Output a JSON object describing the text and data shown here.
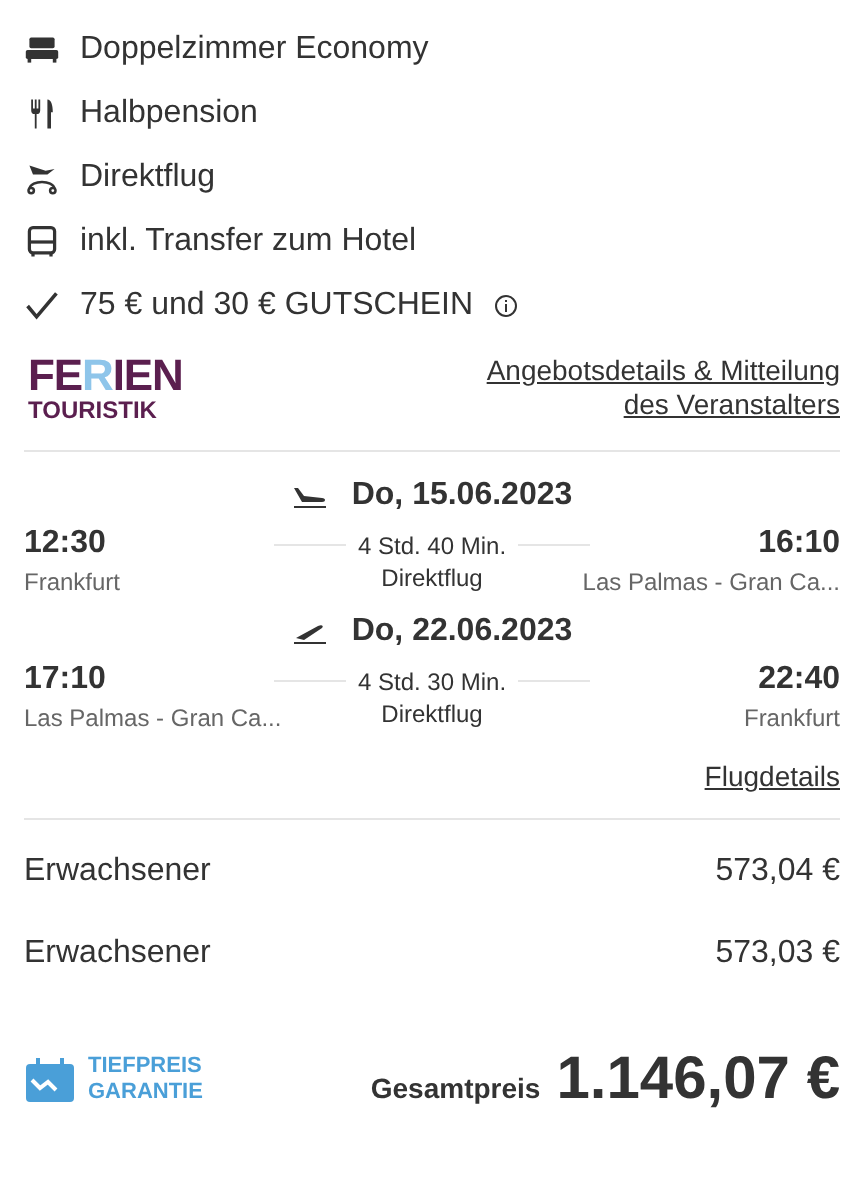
{
  "features": [
    {
      "kind": "bed",
      "text": "Doppelzimmer Economy",
      "info": false
    },
    {
      "kind": "meal",
      "text": "Halbpension",
      "info": false
    },
    {
      "kind": "flight",
      "text": "Direktflug",
      "info": false
    },
    {
      "kind": "bus",
      "text": "inkl. Transfer zum Hotel",
      "info": false
    },
    {
      "kind": "check",
      "text": "75 € und 30 € GUTSCHEIN",
      "info": true
    }
  ],
  "operator": {
    "logo_line1": [
      {
        "text": "FE",
        "color": "#5b1f4f"
      },
      {
        "text": "R",
        "color": "#8ec5ea"
      },
      {
        "text": "IEN",
        "color": "#5b1f4f"
      }
    ],
    "logo_line2": "TOURISTIK",
    "details_link": "Angebotsdetails & Mitteilung des Veranstalters"
  },
  "flights": [
    {
      "kind": "outbound",
      "date": "Do, 15.06.2023",
      "dep_time": "12:30",
      "dep_place": "Frankfurt",
      "duration": "4 Std. 40 Min.",
      "type": "Direktflug",
      "arr_time": "16:10",
      "arr_place": "Las Palmas - Gran Ca..."
    },
    {
      "kind": "return",
      "date": "Do, 22.06.2023",
      "dep_time": "17:10",
      "dep_place": "Las Palmas - Gran Ca...",
      "duration": "4 Std. 30 Min.",
      "type": "Direktflug",
      "arr_time": "22:40",
      "arr_place": "Frankfurt"
    }
  ],
  "flight_details_link": "Flugdetails",
  "travellers": [
    {
      "label": "Erwachsener",
      "price": "573,04 €"
    },
    {
      "label": "Erwachsener",
      "price": "573,03 €"
    }
  ],
  "badge": {
    "line1": "TIEFPREIS",
    "line2": "GARANTIE"
  },
  "total": {
    "label": "Gesamtpreis",
    "value": "1.146,07 €"
  }
}
